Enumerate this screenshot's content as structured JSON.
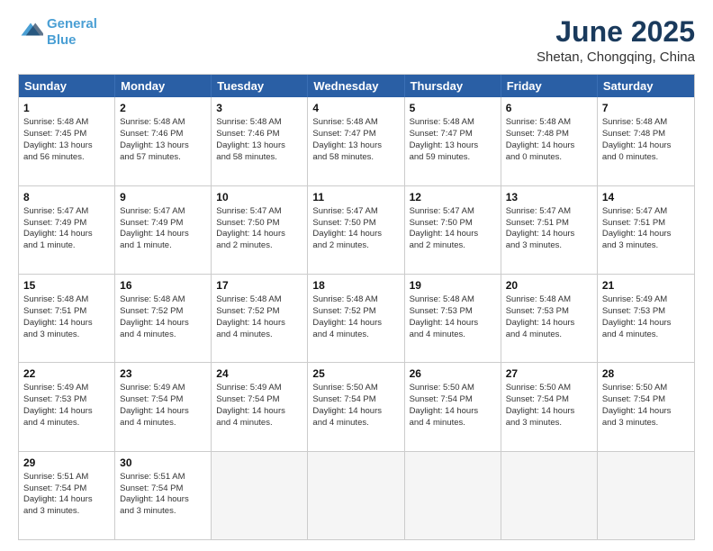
{
  "header": {
    "logo_line1": "General",
    "logo_line2": "Blue",
    "month_title": "June 2025",
    "location": "Shetan, Chongqing, China"
  },
  "days_of_week": [
    "Sunday",
    "Monday",
    "Tuesday",
    "Wednesday",
    "Thursday",
    "Friday",
    "Saturday"
  ],
  "weeks": [
    [
      {
        "day": "1",
        "info": "Sunrise: 5:48 AM\nSunset: 7:45 PM\nDaylight: 13 hours\nand 56 minutes."
      },
      {
        "day": "2",
        "info": "Sunrise: 5:48 AM\nSunset: 7:46 PM\nDaylight: 13 hours\nand 57 minutes."
      },
      {
        "day": "3",
        "info": "Sunrise: 5:48 AM\nSunset: 7:46 PM\nDaylight: 13 hours\nand 58 minutes."
      },
      {
        "day": "4",
        "info": "Sunrise: 5:48 AM\nSunset: 7:47 PM\nDaylight: 13 hours\nand 58 minutes."
      },
      {
        "day": "5",
        "info": "Sunrise: 5:48 AM\nSunset: 7:47 PM\nDaylight: 13 hours\nand 59 minutes."
      },
      {
        "day": "6",
        "info": "Sunrise: 5:48 AM\nSunset: 7:48 PM\nDaylight: 14 hours\nand 0 minutes."
      },
      {
        "day": "7",
        "info": "Sunrise: 5:48 AM\nSunset: 7:48 PM\nDaylight: 14 hours\nand 0 minutes."
      }
    ],
    [
      {
        "day": "8",
        "info": "Sunrise: 5:47 AM\nSunset: 7:49 PM\nDaylight: 14 hours\nand 1 minute."
      },
      {
        "day": "9",
        "info": "Sunrise: 5:47 AM\nSunset: 7:49 PM\nDaylight: 14 hours\nand 1 minute."
      },
      {
        "day": "10",
        "info": "Sunrise: 5:47 AM\nSunset: 7:50 PM\nDaylight: 14 hours\nand 2 minutes."
      },
      {
        "day": "11",
        "info": "Sunrise: 5:47 AM\nSunset: 7:50 PM\nDaylight: 14 hours\nand 2 minutes."
      },
      {
        "day": "12",
        "info": "Sunrise: 5:47 AM\nSunset: 7:50 PM\nDaylight: 14 hours\nand 2 minutes."
      },
      {
        "day": "13",
        "info": "Sunrise: 5:47 AM\nSunset: 7:51 PM\nDaylight: 14 hours\nand 3 minutes."
      },
      {
        "day": "14",
        "info": "Sunrise: 5:47 AM\nSunset: 7:51 PM\nDaylight: 14 hours\nand 3 minutes."
      }
    ],
    [
      {
        "day": "15",
        "info": "Sunrise: 5:48 AM\nSunset: 7:51 PM\nDaylight: 14 hours\nand 3 minutes."
      },
      {
        "day": "16",
        "info": "Sunrise: 5:48 AM\nSunset: 7:52 PM\nDaylight: 14 hours\nand 4 minutes."
      },
      {
        "day": "17",
        "info": "Sunrise: 5:48 AM\nSunset: 7:52 PM\nDaylight: 14 hours\nand 4 minutes."
      },
      {
        "day": "18",
        "info": "Sunrise: 5:48 AM\nSunset: 7:52 PM\nDaylight: 14 hours\nand 4 minutes."
      },
      {
        "day": "19",
        "info": "Sunrise: 5:48 AM\nSunset: 7:53 PM\nDaylight: 14 hours\nand 4 minutes."
      },
      {
        "day": "20",
        "info": "Sunrise: 5:48 AM\nSunset: 7:53 PM\nDaylight: 14 hours\nand 4 minutes."
      },
      {
        "day": "21",
        "info": "Sunrise: 5:49 AM\nSunset: 7:53 PM\nDaylight: 14 hours\nand 4 minutes."
      }
    ],
    [
      {
        "day": "22",
        "info": "Sunrise: 5:49 AM\nSunset: 7:53 PM\nDaylight: 14 hours\nand 4 minutes."
      },
      {
        "day": "23",
        "info": "Sunrise: 5:49 AM\nSunset: 7:54 PM\nDaylight: 14 hours\nand 4 minutes."
      },
      {
        "day": "24",
        "info": "Sunrise: 5:49 AM\nSunset: 7:54 PM\nDaylight: 14 hours\nand 4 minutes."
      },
      {
        "day": "25",
        "info": "Sunrise: 5:50 AM\nSunset: 7:54 PM\nDaylight: 14 hours\nand 4 minutes."
      },
      {
        "day": "26",
        "info": "Sunrise: 5:50 AM\nSunset: 7:54 PM\nDaylight: 14 hours\nand 4 minutes."
      },
      {
        "day": "27",
        "info": "Sunrise: 5:50 AM\nSunset: 7:54 PM\nDaylight: 14 hours\nand 3 minutes."
      },
      {
        "day": "28",
        "info": "Sunrise: 5:50 AM\nSunset: 7:54 PM\nDaylight: 14 hours\nand 3 minutes."
      }
    ],
    [
      {
        "day": "29",
        "info": "Sunrise: 5:51 AM\nSunset: 7:54 PM\nDaylight: 14 hours\nand 3 minutes."
      },
      {
        "day": "30",
        "info": "Sunrise: 5:51 AM\nSunset: 7:54 PM\nDaylight: 14 hours\nand 3 minutes."
      },
      {
        "day": "",
        "info": ""
      },
      {
        "day": "",
        "info": ""
      },
      {
        "day": "",
        "info": ""
      },
      {
        "day": "",
        "info": ""
      },
      {
        "day": "",
        "info": ""
      }
    ]
  ]
}
